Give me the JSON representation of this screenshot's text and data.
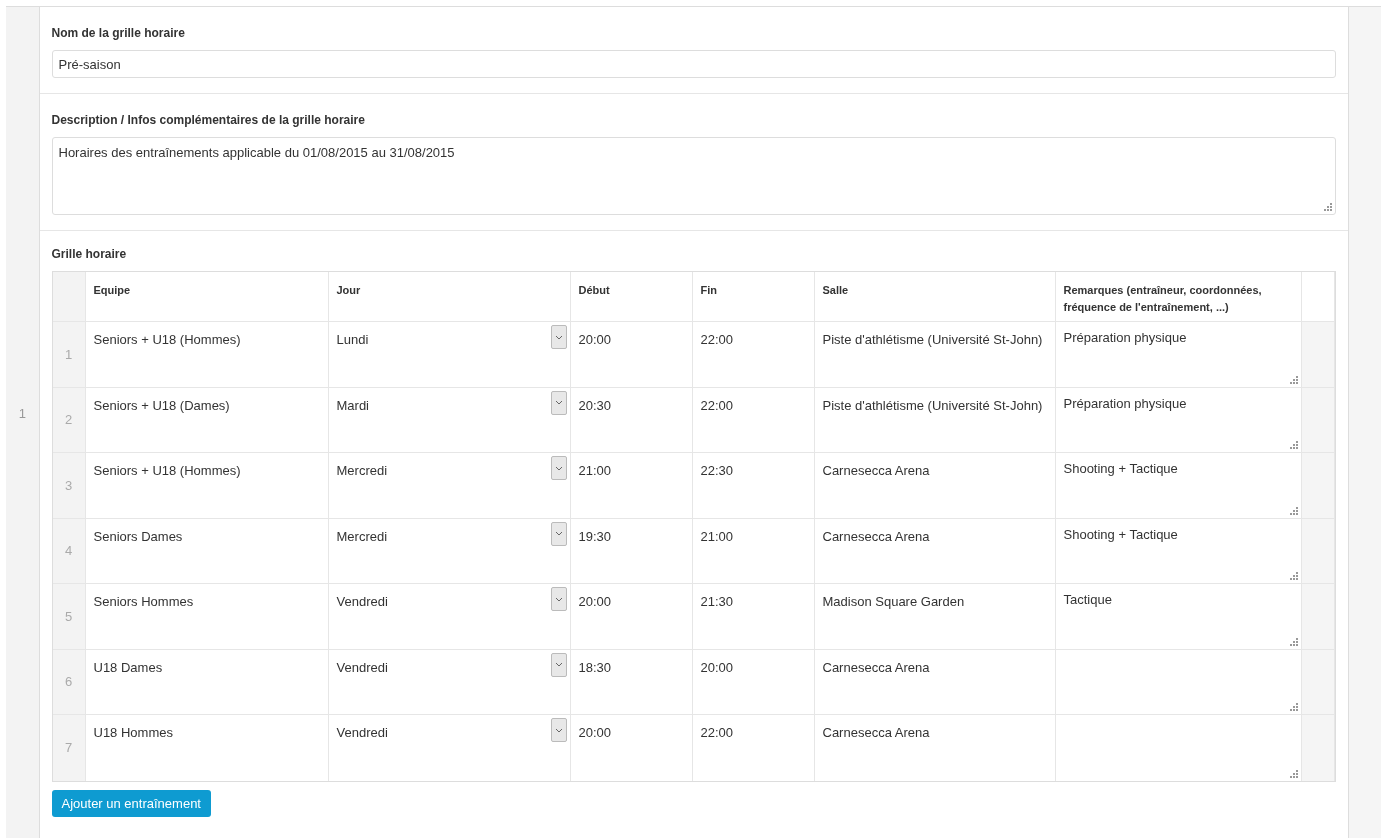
{
  "record_index": "1",
  "name_field": {
    "label": "Nom de la grille horaire",
    "value": "Pré-saison"
  },
  "description_field": {
    "label": "Description / Infos complémentaires de la grille horaire",
    "value": "Horaires des entraînements applicable du 01/08/2015 au 31/08/2015"
  },
  "schedule": {
    "label": "Grille horaire",
    "columns": [
      "Equipe",
      "Jour",
      "Début",
      "Fin",
      "Salle",
      "Remarques (entraîneur, coordonnées, fréquence de l'entraînement, ...)"
    ],
    "rows": [
      {
        "index": "1",
        "team": "Seniors + U18 (Hommes)",
        "day": "Lundi",
        "start": "20:00",
        "end": "22:00",
        "venue": "Piste d'athlétisme (Université St-John)",
        "remarks": "Préparation physique"
      },
      {
        "index": "2",
        "team": "Seniors + U18 (Dames)",
        "day": "Mardi",
        "start": "20:30",
        "end": "22:00",
        "venue": "Piste d'athlétisme (Université St-John)",
        "remarks": "Préparation physique"
      },
      {
        "index": "3",
        "team": "Seniors + U18 (Hommes)",
        "day": "Mercredi",
        "start": "21:00",
        "end": "22:30",
        "venue": "Carnesecca Arena",
        "remarks": "Shooting + Tactique"
      },
      {
        "index": "4",
        "team": "Seniors Dames",
        "day": "Mercredi",
        "start": "19:30",
        "end": "21:00",
        "venue": "Carnesecca Arena",
        "remarks": "Shooting + Tactique"
      },
      {
        "index": "5",
        "team": "Seniors Hommes",
        "day": "Vendredi",
        "start": "20:00",
        "end": "21:30",
        "venue": "Madison Square Garden",
        "remarks": "Tactique"
      },
      {
        "index": "6",
        "team": "U18 Dames",
        "day": "Vendredi",
        "start": "18:30",
        "end": "20:00",
        "venue": "Carnesecca Arena",
        "remarks": ""
      },
      {
        "index": "7",
        "team": "U18 Hommes",
        "day": "Vendredi",
        "start": "20:00",
        "end": "22:00",
        "venue": "Carnesecca Arena",
        "remarks": ""
      }
    ]
  },
  "add_button": "Ajouter un entraînement"
}
